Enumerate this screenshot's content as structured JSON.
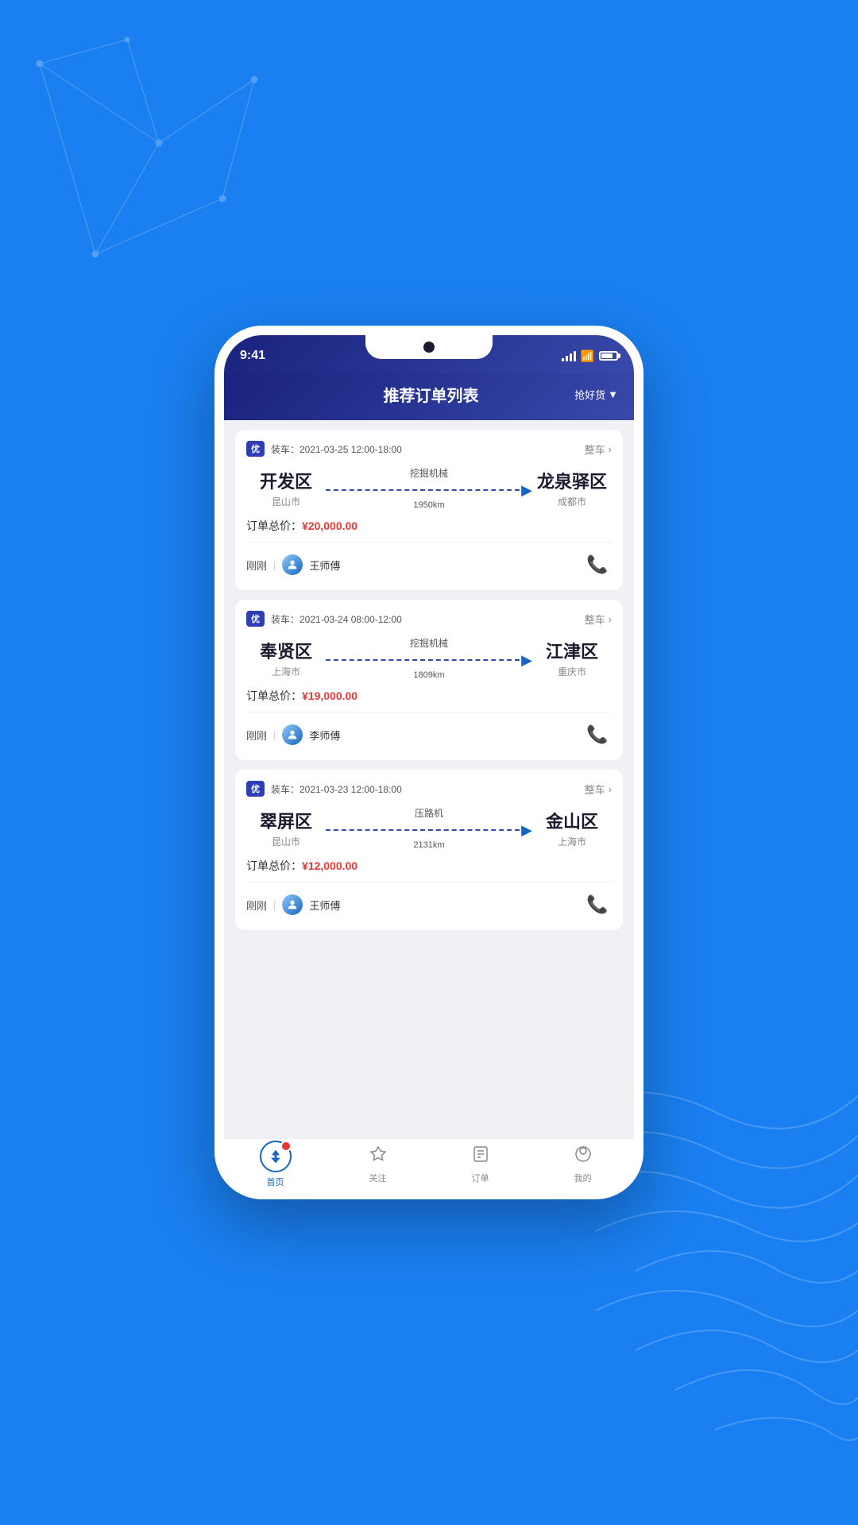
{
  "app": {
    "background_color": "#1a7ff0"
  },
  "status_bar": {
    "time": "9:41",
    "signal_level": 4,
    "wifi": true,
    "battery_percent": 80
  },
  "header": {
    "title": "推荐订单列表",
    "action_label": "抢好货",
    "action_icon": "filter"
  },
  "orders": [
    {
      "id": "order-1",
      "badge": "优",
      "date": "装车：2021-03-25 12:00-18:00",
      "type": "整车",
      "from_city": "开发区",
      "from_sub": "昆山市",
      "goods": "挖掘机械",
      "distance": "1950km",
      "to_city": "龙泉驿区",
      "to_sub": "成都市",
      "price_label": "订单总价：",
      "price": "¥20,000.00",
      "time_ago": "刚刚",
      "driver_name": "王师傅"
    },
    {
      "id": "order-2",
      "badge": "优",
      "date": "装车：2021-03-24 08:00-12:00",
      "type": "整车",
      "from_city": "奉贤区",
      "from_sub": "上海市",
      "goods": "挖掘机械",
      "distance": "1809km",
      "to_city": "江津区",
      "to_sub": "重庆市",
      "price_label": "订单总价：",
      "price": "¥19,000.00",
      "time_ago": "刚刚",
      "driver_name": "李师傅"
    },
    {
      "id": "order-3",
      "badge": "优",
      "date": "装车：2021-03-23 12:00-18:00",
      "type": "整车",
      "from_city": "翠屏区",
      "from_sub": "昆山市",
      "goods": "压路机",
      "distance": "2131km",
      "to_city": "金山区",
      "to_sub": "上海市",
      "price_label": "订单总价：",
      "price": "¥12,000.00",
      "time_ago": "刚刚",
      "driver_name": "王师傅"
    }
  ],
  "bottom_nav": {
    "items": [
      {
        "id": "home",
        "label": "首页",
        "active": true
      },
      {
        "id": "follow",
        "label": "关注",
        "active": false
      },
      {
        "id": "orders",
        "label": "订单",
        "active": false
      },
      {
        "id": "mine",
        "label": "我的",
        "active": false
      }
    ]
  }
}
